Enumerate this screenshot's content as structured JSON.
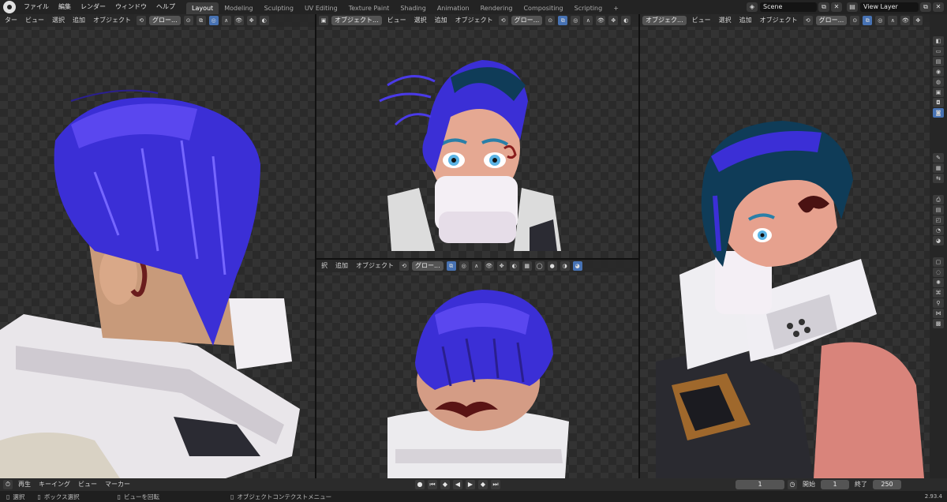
{
  "topbar": {
    "menus": [
      "ファイル",
      "編集",
      "レンダー",
      "ウィンドウ",
      "ヘルプ"
    ],
    "workspaces": [
      "Layout",
      "Modeling",
      "Sculpting",
      "UV Editing",
      "Texture Paint",
      "Shading",
      "Animation",
      "Rendering",
      "Compositing",
      "Scripting"
    ],
    "active_workspace": "Layout",
    "add_tab": "+",
    "scene": "Scene",
    "view_layer": "View Layer"
  },
  "viewports": {
    "left": {
      "menus": [
        "ビュー",
        "選択",
        "追加",
        "オブジェクト"
      ],
      "prefix": "ター",
      "transform": "グロー..."
    },
    "top_center": {
      "mode": "オブジェクト...",
      "menus": [
        "ビュー",
        "選択",
        "追加",
        "オブジェクト"
      ],
      "transform": "グロー..."
    },
    "right": {
      "mode": "オブジェク...",
      "menus": [
        "ビュー",
        "選択",
        "追加",
        "オブジェクト"
      ],
      "transform": "グロー..."
    },
    "bottom_center": {
      "menus": [
        "択",
        "追加",
        "オブジェクト"
      ],
      "transform": "グロー..."
    }
  },
  "timeline": {
    "menus": [
      "再生",
      "キーイング",
      "ビュー",
      "マーカー"
    ],
    "current_frame": "1",
    "start_label": "開始",
    "start": "1",
    "end_label": "終了",
    "end": "250"
  },
  "statusbar": {
    "select": "選択",
    "box_select": "ボックス選択",
    "rotate_view": "ビューを回転",
    "context_menu": "オブジェクトコンテクストメニュー",
    "version": "2.93.4"
  },
  "colors": {
    "accent": "#4772b3",
    "hair_blue": "#3b2fd6",
    "background": "#1d1d1d"
  }
}
